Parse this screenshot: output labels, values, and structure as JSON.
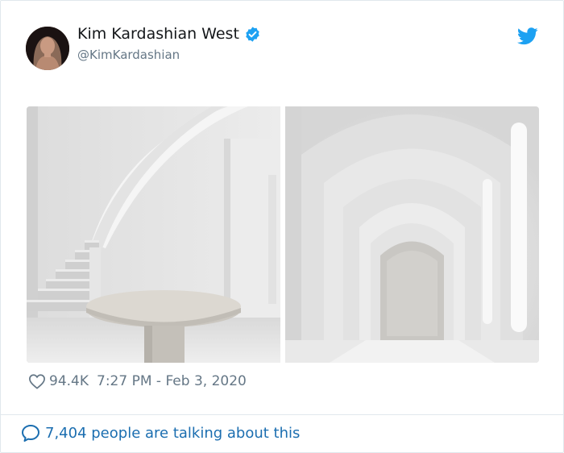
{
  "author": {
    "display_name": "Kim Kardashian West",
    "handle": "@KimKardashian",
    "verified": true,
    "avatar_icon": "profile-photo"
  },
  "icons": {
    "verified": "verified-badge-icon",
    "brand": "twitter-bird-icon",
    "like": "heart-icon",
    "conversation": "speech-bubble-icon"
  },
  "media": {
    "images": [
      "staircase-photo",
      "arched-hallway-photo"
    ]
  },
  "tweet_meta": {
    "like_count": "94.4K",
    "timestamp": "7:27 PM - Feb 3, 2020"
  },
  "conversation": {
    "label": "7,404 people are talking about this"
  },
  "colors": {
    "brand_blue": "#1da1f2",
    "link_blue": "#1b6eb0",
    "muted_text": "#657786",
    "primary_text": "#14171a",
    "border": "#e1e8ed"
  }
}
